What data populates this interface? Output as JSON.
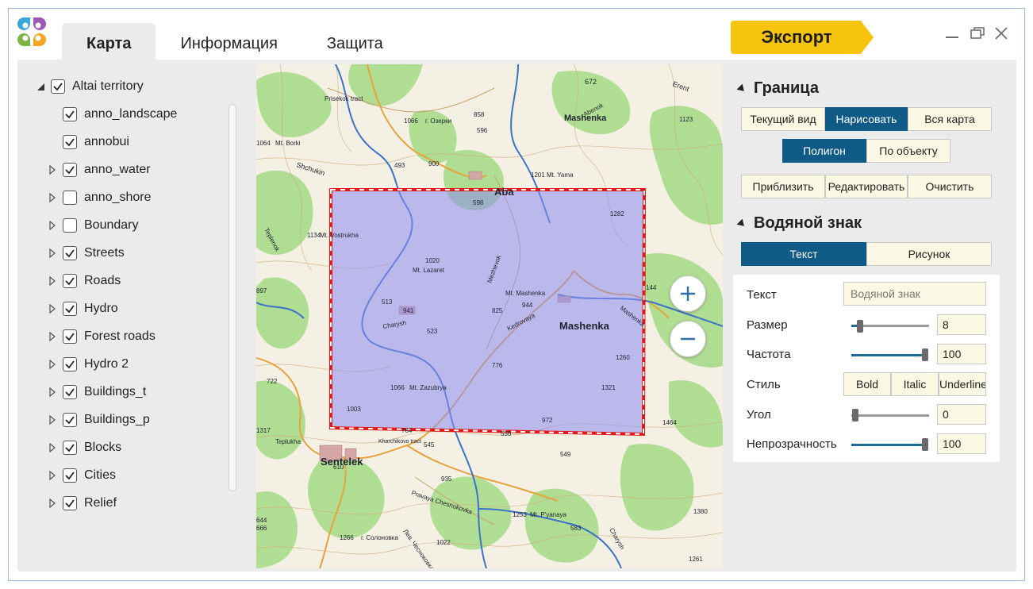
{
  "tabs": [
    {
      "label": "Карта",
      "active": true
    },
    {
      "label": "Информация",
      "active": false
    },
    {
      "label": "Защита",
      "active": false
    }
  ],
  "export_label": "Экспорт",
  "layers": [
    {
      "label": "Altai territory",
      "checked": true,
      "level": 0,
      "expander": "expanded"
    },
    {
      "label": "anno_landscape",
      "checked": true,
      "level": 1,
      "expander": "none"
    },
    {
      "label": "annobui",
      "checked": true,
      "level": 1,
      "expander": "none"
    },
    {
      "label": "anno_water",
      "checked": true,
      "level": 1,
      "expander": "collapsed"
    },
    {
      "label": "anno_shore",
      "checked": false,
      "level": 1,
      "expander": "collapsed"
    },
    {
      "label": "Boundary",
      "checked": false,
      "level": 1,
      "expander": "collapsed"
    },
    {
      "label": "Streets",
      "checked": true,
      "level": 1,
      "expander": "collapsed"
    },
    {
      "label": "Roads",
      "checked": true,
      "level": 1,
      "expander": "collapsed"
    },
    {
      "label": "Hydro",
      "checked": true,
      "level": 1,
      "expander": "collapsed"
    },
    {
      "label": "Forest roads",
      "checked": true,
      "level": 1,
      "expander": "collapsed"
    },
    {
      "label": "Hydro 2",
      "checked": true,
      "level": 1,
      "expander": "collapsed"
    },
    {
      "label": "Buildings_t",
      "checked": true,
      "level": 1,
      "expander": "collapsed"
    },
    {
      "label": "Buildings_p",
      "checked": true,
      "level": 1,
      "expander": "collapsed"
    },
    {
      "label": "Blocks",
      "checked": true,
      "level": 1,
      "expander": "collapsed"
    },
    {
      "label": "Cities",
      "checked": true,
      "level": 1,
      "expander": "collapsed"
    },
    {
      "label": "Relief",
      "checked": true,
      "level": 1,
      "expander": "collapsed"
    }
  ],
  "map_labels": [
    {
      "text": "672"
    },
    {
      "text": "Erent"
    },
    {
      "text": "Prisekok tract"
    },
    {
      "text": "1066"
    },
    {
      "text": "г. Озерки"
    },
    {
      "text": "858"
    },
    {
      "text": "596"
    },
    {
      "text": "Mashenka"
    },
    {
      "text": "Abenok"
    },
    {
      "text": "1123"
    },
    {
      "text": "1064"
    },
    {
      "text": "Mt. Borki"
    },
    {
      "text": "Shchukin"
    },
    {
      "text": "493"
    },
    {
      "text": "900"
    },
    {
      "text": "1201"
    },
    {
      "text": "Mt. Yama"
    },
    {
      "text": "Aba"
    },
    {
      "text": "598"
    },
    {
      "text": "1282"
    },
    {
      "text": "1134"
    },
    {
      "text": "Mt. Vostrukha"
    },
    {
      "text": "1020"
    },
    {
      "text": "Mt. Lazaret"
    },
    {
      "text": "Mezhevok"
    },
    {
      "text": "897"
    },
    {
      "text": "Mt. Mashenka"
    },
    {
      "text": "944"
    },
    {
      "text": "144"
    },
    {
      "text": "513"
    },
    {
      "text": "941"
    },
    {
      "text": "825"
    },
    {
      "text": "Kedrovaya"
    },
    {
      "text": "Mashenka"
    },
    {
      "text": "Charysh"
    },
    {
      "text": "523"
    },
    {
      "text": "776"
    },
    {
      "text": "1260"
    },
    {
      "text": "722"
    },
    {
      "text": "1066"
    },
    {
      "text": "Mt. Zazubrya"
    },
    {
      "text": "1321"
    },
    {
      "text": "1003"
    },
    {
      "text": "972"
    },
    {
      "text": "1464"
    },
    {
      "text": "1317"
    },
    {
      "text": "764"
    },
    {
      "text": "556"
    },
    {
      "text": "Kharchikovo tract"
    },
    {
      "text": "545"
    },
    {
      "text": "Teplukha"
    },
    {
      "text": "Sentelek"
    },
    {
      "text": "610"
    },
    {
      "text": "549"
    },
    {
      "text": "935"
    },
    {
      "text": "Pravaya Chesnokovka"
    },
    {
      "text": "1253"
    },
    {
      "text": "Mt. P'yanaya"
    },
    {
      "text": "1380"
    },
    {
      "text": "644"
    },
    {
      "text": "666"
    },
    {
      "text": "583"
    },
    {
      "text": "1266"
    },
    {
      "text": "г. Солоновка"
    },
    {
      "text": "Charysh"
    },
    {
      "text": "1022"
    },
    {
      "text": "1261"
    },
    {
      "text": "Teplenok"
    },
    {
      "text": "Mashenka"
    },
    {
      "text": "Лев. Чесноковка"
    }
  ],
  "border": {
    "title": "Граница",
    "scope_buttons": [
      {
        "label": "Текущий вид",
        "active": false
      },
      {
        "label": "Нарисовать",
        "active": true
      },
      {
        "label": "Вся карта",
        "active": false
      }
    ],
    "mode_buttons": [
      {
        "label": "Полигон",
        "active": true
      },
      {
        "label": "По объекту",
        "active": false
      }
    ],
    "action_buttons": [
      {
        "label": "Приблизить"
      },
      {
        "label": "Редактировать"
      },
      {
        "label": "Очистить"
      }
    ]
  },
  "watermark": {
    "title": "Водяной знак",
    "type_buttons": [
      {
        "label": "Текст",
        "active": true
      },
      {
        "label": "Рисунок",
        "active": false
      }
    ],
    "text_label": "Текст",
    "text_placeholder": "Водяной знак",
    "size_label": "Размер",
    "size_value": "8",
    "frequency_label": "Частота",
    "frequency_value": "100",
    "style_label": "Стиль",
    "style_buttons": [
      {
        "label": "Bold"
      },
      {
        "label": "Italic"
      },
      {
        "label": "Underline"
      }
    ],
    "angle_label": "Угол",
    "angle_value": "0",
    "opacity_label": "Непрозрачность",
    "opacity_value": "100"
  },
  "colors": {
    "accent": "#0f5a86",
    "export": "#f6c30f",
    "selection_fill": "#8c8cf0",
    "selection_border": "#e01818"
  }
}
